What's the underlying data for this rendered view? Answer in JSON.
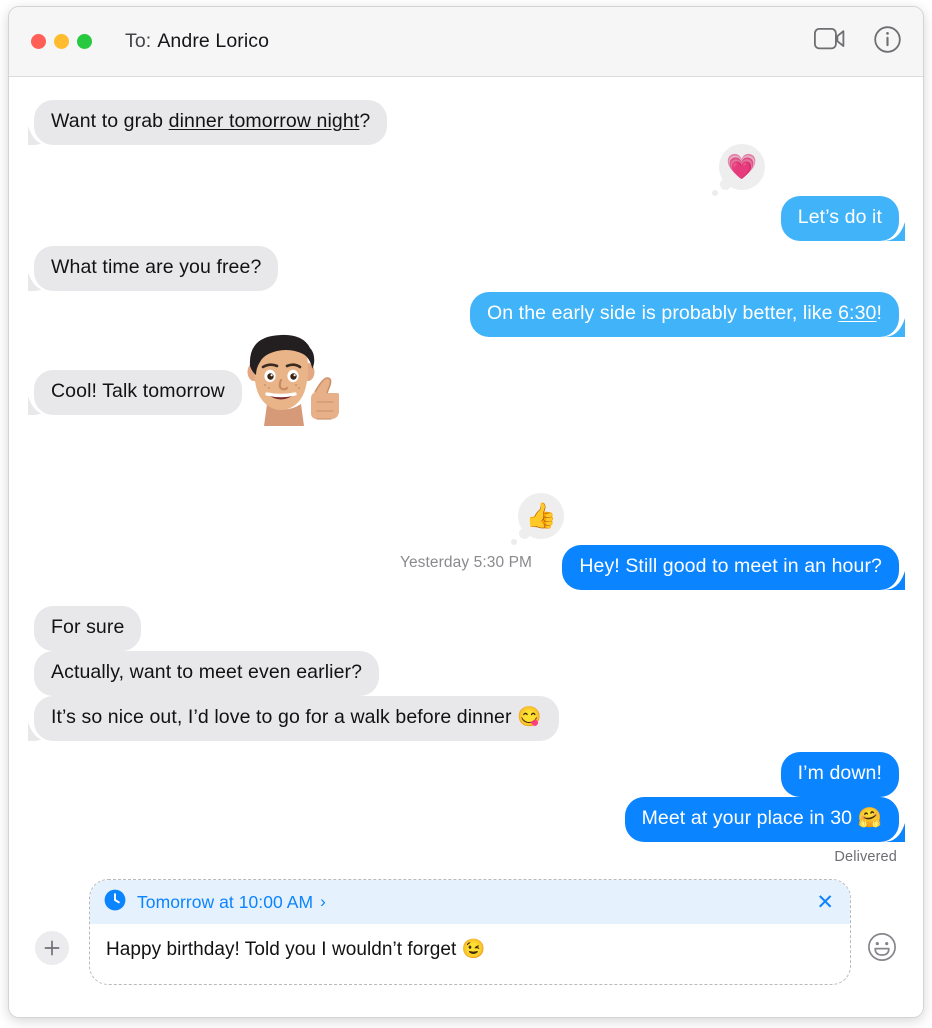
{
  "window": {
    "traffic_lights": [
      {
        "name": "close",
        "color": "#ff5f57"
      },
      {
        "name": "minimize",
        "color": "#febc2e"
      },
      {
        "name": "zoom",
        "color": "#28c840"
      }
    ]
  },
  "titlebar": {
    "to_label": "To:",
    "recipient": "Andre Lorico",
    "actions": [
      {
        "name": "facetime-video-icon",
        "label": "FaceTime Video"
      },
      {
        "name": "details-info-icon",
        "label": "Details"
      }
    ]
  },
  "conversation": {
    "timestamp_divider": "Yesterday 5:30 PM",
    "delivered_label": "Delivered",
    "messages": [
      {
        "id": "m1",
        "side": "left",
        "style": "gray",
        "text_before": "Want to grab ",
        "link": "dinner tomorrow night",
        "text_after": "?",
        "full_text": "Want to grab dinner tomorrow night?",
        "tail": true
      },
      {
        "id": "m2",
        "side": "right",
        "style": "blue-light",
        "full_text": "Let’s do it",
        "tail": true,
        "tapback": {
          "emoji": "💗",
          "name": "heart-tapback"
        }
      },
      {
        "id": "m3",
        "side": "left",
        "style": "gray",
        "full_text": "What time are you free?",
        "tail": true
      },
      {
        "id": "m4",
        "side": "right",
        "style": "blue-light",
        "text_before": "On the early side is probably better, like ",
        "link": "6:30",
        "text_after": "!",
        "full_text": "On the early side is probably better, like 6:30!",
        "tail": true
      },
      {
        "id": "m5",
        "side": "left",
        "style": "gray",
        "full_text": "Cool! Talk tomorrow",
        "tail": true,
        "sticker": {
          "name": "memoji-thumbs-up-sticker"
        }
      },
      {
        "id": "m6",
        "side": "right",
        "style": "blue",
        "full_text": "Hey! Still good to meet in an hour?",
        "tail": true,
        "tapback": {
          "emoji": "👍",
          "name": "thumbs-up-tapback"
        }
      },
      {
        "id": "m7",
        "side": "left",
        "style": "gray",
        "full_text": "For sure",
        "tail": false
      },
      {
        "id": "m8",
        "side": "left",
        "style": "gray",
        "full_text": "Actually, want to meet even earlier?",
        "tail": false
      },
      {
        "id": "m9",
        "side": "left",
        "style": "gray",
        "full_text": "It’s so nice out, I’d love to go for a walk before dinner 😋",
        "tail": true
      },
      {
        "id": "m10",
        "side": "right",
        "style": "blue",
        "full_text": "I’m down!",
        "tail": false
      },
      {
        "id": "m11",
        "side": "right",
        "style": "blue",
        "full_text": "Meet at your place in 30 🤗",
        "tail": true
      }
    ]
  },
  "compose": {
    "plus_button_label": "+",
    "schedule": {
      "icon": "clock-icon",
      "text": "Tomorrow at 10:00 AM",
      "chevron": "›",
      "close": "✕"
    },
    "draft_text": "Happy birthday! Told you I wouldn’t forget 😉",
    "emoji_button": "emoji-smiley-icon"
  },
  "colors": {
    "accent_blue": "#0b84ff",
    "bubble_blue_light": "#41b3f9",
    "bubble_gray": "#e8e8ea",
    "titlebar": "#f6f6f6",
    "schedule_banner": "#e6f1fe"
  }
}
